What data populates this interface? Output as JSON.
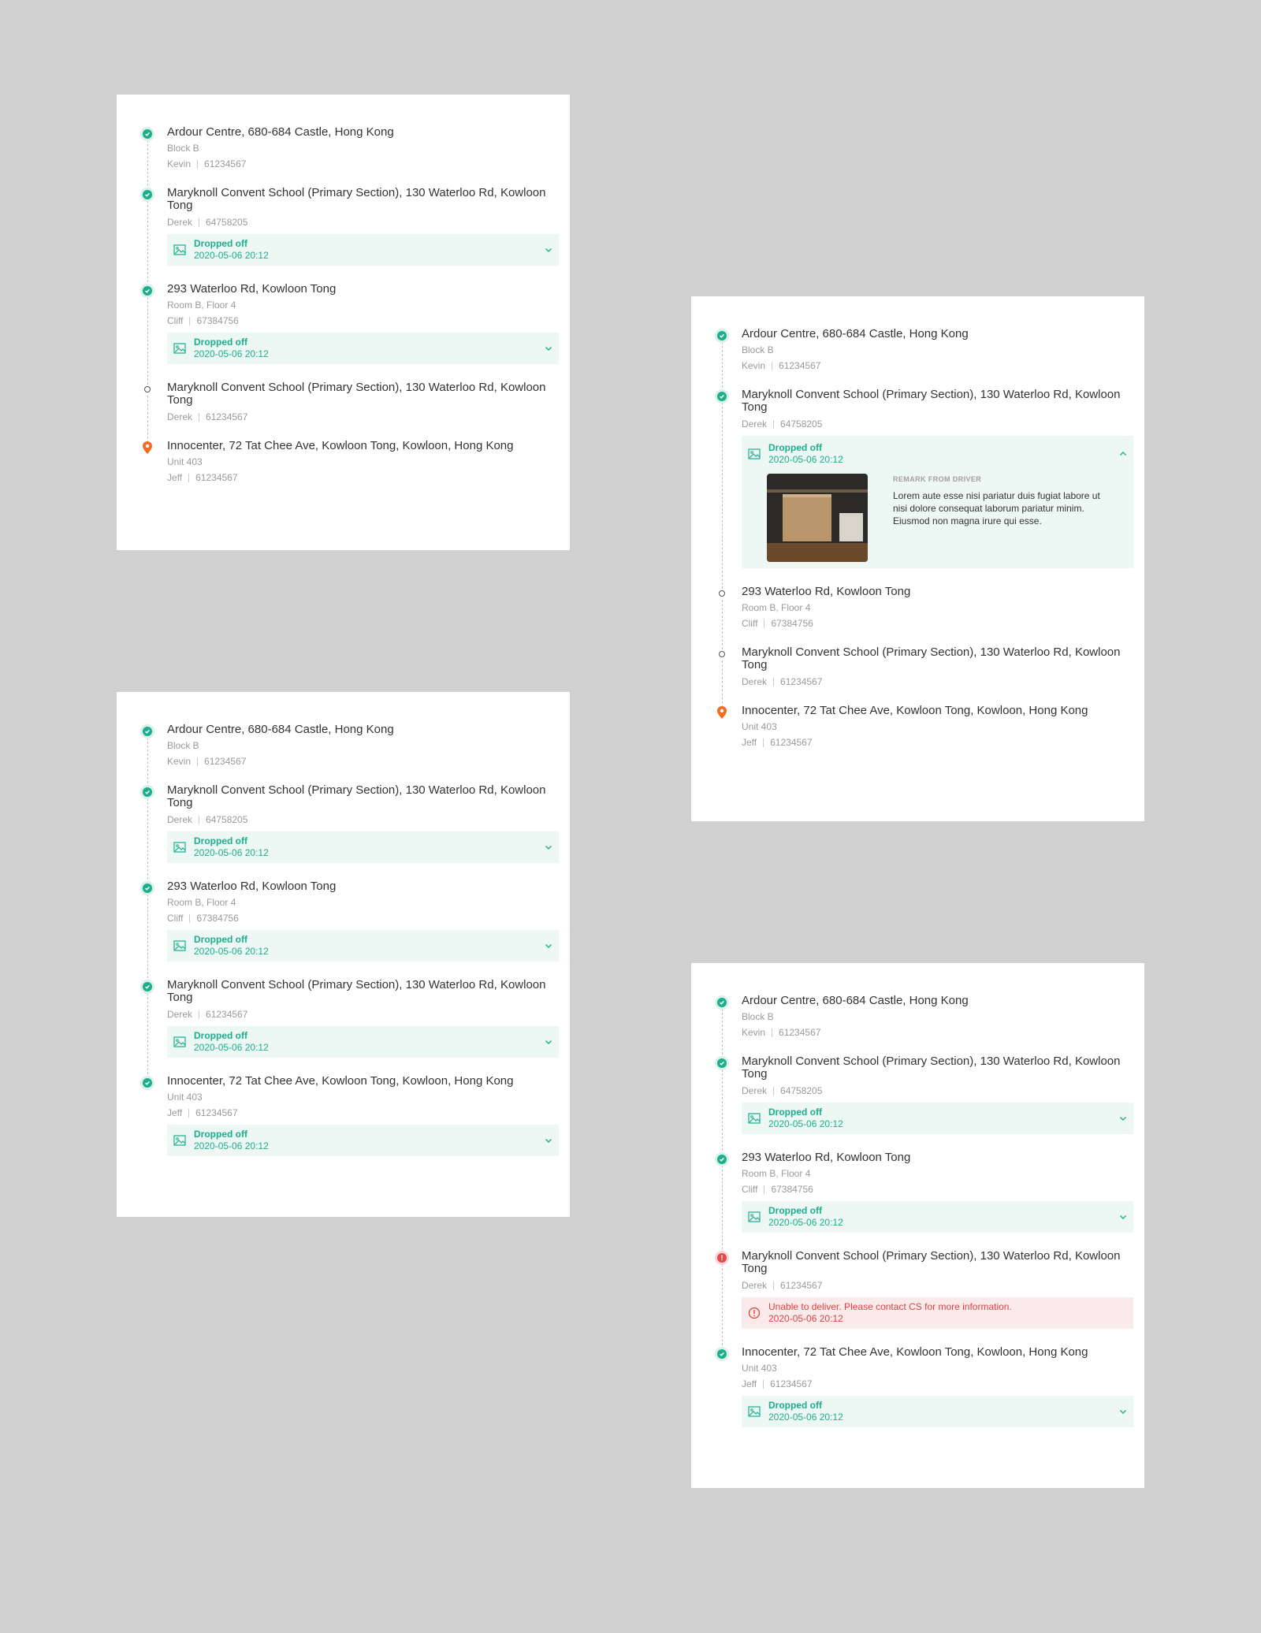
{
  "colors": {
    "success": "#1eae8c",
    "error": "#d64545",
    "destination": "#f26b21",
    "background": "#d1d1d1"
  },
  "icons": {
    "done": "check-circle-icon",
    "failed": "exclamation-circle-icon",
    "pending": "hollow-dot-icon",
    "destination": "map-pin-icon",
    "photo": "image-icon",
    "expand": "chevron-down-icon",
    "collapse": "chevron-up-icon",
    "alert": "alert-circle-icon"
  },
  "card1": {
    "stops": [
      {
        "address": "Ardour Centre, 680-684 Castle, Hong Kong",
        "unit": "Block B",
        "name": "Kevin",
        "phone": "61234567"
      },
      {
        "address": "Maryknoll Convent School (Primary Section), 130 Waterloo Rd, Kowloon Tong",
        "name": "Derek",
        "phone": "64758205",
        "status": "Dropped off",
        "time": "2020-05-06 20:12"
      },
      {
        "address": "293 Waterloo Rd, Kowloon Tong",
        "unit": "Room B, Floor 4",
        "name": "Cliff",
        "phone": "67384756",
        "status": "Dropped off",
        "time": "2020-05-06 20:12"
      },
      {
        "address": "Maryknoll Convent School (Primary Section), 130 Waterloo Rd, Kowloon Tong",
        "name": "Derek",
        "phone": "61234567"
      },
      {
        "address": "Innocenter, 72 Tat Chee Ave, Kowloon Tong, Kowloon, Hong Kong",
        "unit": "Unit 403",
        "name": "Jeff",
        "phone": "61234567"
      }
    ]
  },
  "card2": {
    "stops": [
      {
        "address": "Ardour Centre, 680-684 Castle, Hong Kong",
        "unit": "Block B",
        "name": "Kevin",
        "phone": "61234567"
      },
      {
        "address": "Maryknoll Convent School (Primary Section), 130 Waterloo Rd, Kowloon Tong",
        "name": "Derek",
        "phone": "64758205",
        "status": "Dropped off",
        "time": "2020-05-06 20:12",
        "remark_title": "REMARK FROM DRIVER",
        "remark": "Lorem aute esse nisi pariatur duis fugiat labore ut nisi dolore consequat laborum pariatur minim. Eiusmod non magna irure qui esse."
      },
      {
        "address": "293 Waterloo Rd, Kowloon Tong",
        "unit": "Room B, Floor 4",
        "name": "Cliff",
        "phone": "67384756"
      },
      {
        "address": "Maryknoll Convent School (Primary Section), 130 Waterloo Rd, Kowloon Tong",
        "name": "Derek",
        "phone": "61234567"
      },
      {
        "address": "Innocenter, 72 Tat Chee Ave, Kowloon Tong, Kowloon, Hong Kong",
        "unit": "Unit 403",
        "name": "Jeff",
        "phone": "61234567"
      }
    ]
  },
  "card3": {
    "stops": [
      {
        "address": "Ardour Centre, 680-684 Castle, Hong Kong",
        "unit": "Block B",
        "name": "Kevin",
        "phone": "61234567"
      },
      {
        "address": "Maryknoll Convent School (Primary Section), 130 Waterloo Rd, Kowloon Tong",
        "name": "Derek",
        "phone": "64758205",
        "status": "Dropped off",
        "time": "2020-05-06 20:12"
      },
      {
        "address": "293 Waterloo Rd, Kowloon Tong",
        "unit": "Room B, Floor 4",
        "name": "Cliff",
        "phone": "67384756",
        "status": "Dropped off",
        "time": "2020-05-06 20:12"
      },
      {
        "address": "Maryknoll Convent School (Primary Section), 130 Waterloo Rd, Kowloon Tong",
        "name": "Derek",
        "phone": "61234567",
        "status": "Dropped off",
        "time": "2020-05-06 20:12"
      },
      {
        "address": "Innocenter, 72 Tat Chee Ave, Kowloon Tong, Kowloon, Hong Kong",
        "unit": "Unit 403",
        "name": "Jeff",
        "phone": "61234567",
        "status": "Dropped off",
        "time": "2020-05-06 20:12"
      }
    ]
  },
  "card4": {
    "stops": [
      {
        "address": "Ardour Centre, 680-684 Castle, Hong Kong",
        "unit": "Block B",
        "name": "Kevin",
        "phone": "61234567"
      },
      {
        "address": "Maryknoll Convent School (Primary Section), 130 Waterloo Rd, Kowloon Tong",
        "name": "Derek",
        "phone": "64758205",
        "status": "Dropped off",
        "time": "2020-05-06 20:12"
      },
      {
        "address": "293 Waterloo Rd, Kowloon Tong",
        "unit": "Room B, Floor 4",
        "name": "Cliff",
        "phone": "67384756",
        "status": "Dropped off",
        "time": "2020-05-06 20:12"
      },
      {
        "address": "Maryknoll Convent School (Primary Section), 130 Waterloo Rd, Kowloon Tong",
        "name": "Derek",
        "phone": "61234567",
        "status": "Unable to deliver. Please contact CS for more information.",
        "time": "2020-05-06 20:12"
      },
      {
        "address": "Innocenter, 72 Tat Chee Ave, Kowloon Tong, Kowloon, Hong Kong",
        "unit": "Unit 403",
        "name": "Jeff",
        "phone": "61234567",
        "status": "Dropped off",
        "time": "2020-05-06 20:12"
      }
    ]
  }
}
